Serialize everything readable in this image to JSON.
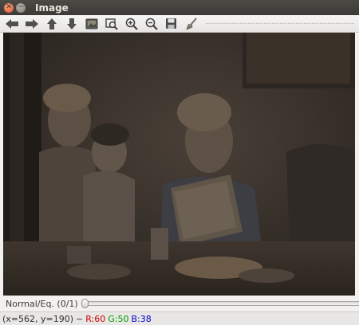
{
  "window": {
    "title": "Image",
    "controls": [
      "close-icon",
      "minimize-icon"
    ]
  },
  "toolbar": {
    "buttons": [
      {
        "name": "left-arrow-icon",
        "color": "#4a4a4a"
      },
      {
        "name": "right-arrow-icon",
        "color": "#4a4a4a"
      },
      {
        "name": "up-arrow-icon",
        "color": "#4a4a4a"
      },
      {
        "name": "down-arrow-icon",
        "color": "#4a4a4a"
      },
      {
        "name": "image-icon",
        "color": "#4a4a4a"
      },
      {
        "name": "zoom-region-icon",
        "color": "#4a4a4a"
      },
      {
        "name": "zoom-in-icon",
        "color": "#4a4a4a"
      },
      {
        "name": "zoom-out-icon",
        "color": "#4a4a4a"
      },
      {
        "name": "save-icon",
        "color": "#4a4a4a"
      },
      {
        "name": "properties-icon",
        "color": "#4a4a4a"
      }
    ]
  },
  "image": {
    "description_colors": [
      "#2d2822",
      "#5a4e44",
      "#7a6a5c"
    ]
  },
  "trackbar": {
    "label": "Normal/Eq. (0/1)",
    "value": 0,
    "max": 1
  },
  "status": {
    "coords": "(x=562, y=190)",
    "separator": "~",
    "r": "R:60",
    "g": "G:50",
    "b": "B:38",
    "r_color": "#cc0000",
    "g_color": "#00a000",
    "b_color": "#0000cc"
  }
}
